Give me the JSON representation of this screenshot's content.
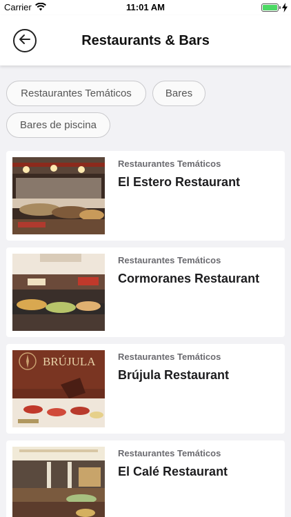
{
  "status_bar": {
    "carrier": "Carrier",
    "time": "11:01 AM",
    "battery_level": 1.0,
    "battery_color": "#4cd964"
  },
  "header": {
    "title": "Restaurants & Bars",
    "back_icon": "arrow-left-icon"
  },
  "filters": [
    {
      "label": "Restaurantes Temáticos"
    },
    {
      "label": "Bares"
    },
    {
      "label": "Bares de piscina"
    }
  ],
  "restaurants": [
    {
      "category": "Restaurantes Temáticos",
      "name": "El Estero Restaurant"
    },
    {
      "category": "Restaurantes Temáticos",
      "name": "Cormoranes Restaurant"
    },
    {
      "category": "Restaurantes Temáticos",
      "name": "Brújula Restaurant",
      "image_sign": "BRÚJULA"
    },
    {
      "category": "Restaurantes Temáticos",
      "name": "El Calé Restaurant"
    }
  ],
  "colors": {
    "background": "#f2f2f5",
    "card": "#ffffff",
    "text_primary": "#1c1c1e",
    "text_secondary": "#6b6b70",
    "chip_border": "#c9c9cc"
  }
}
